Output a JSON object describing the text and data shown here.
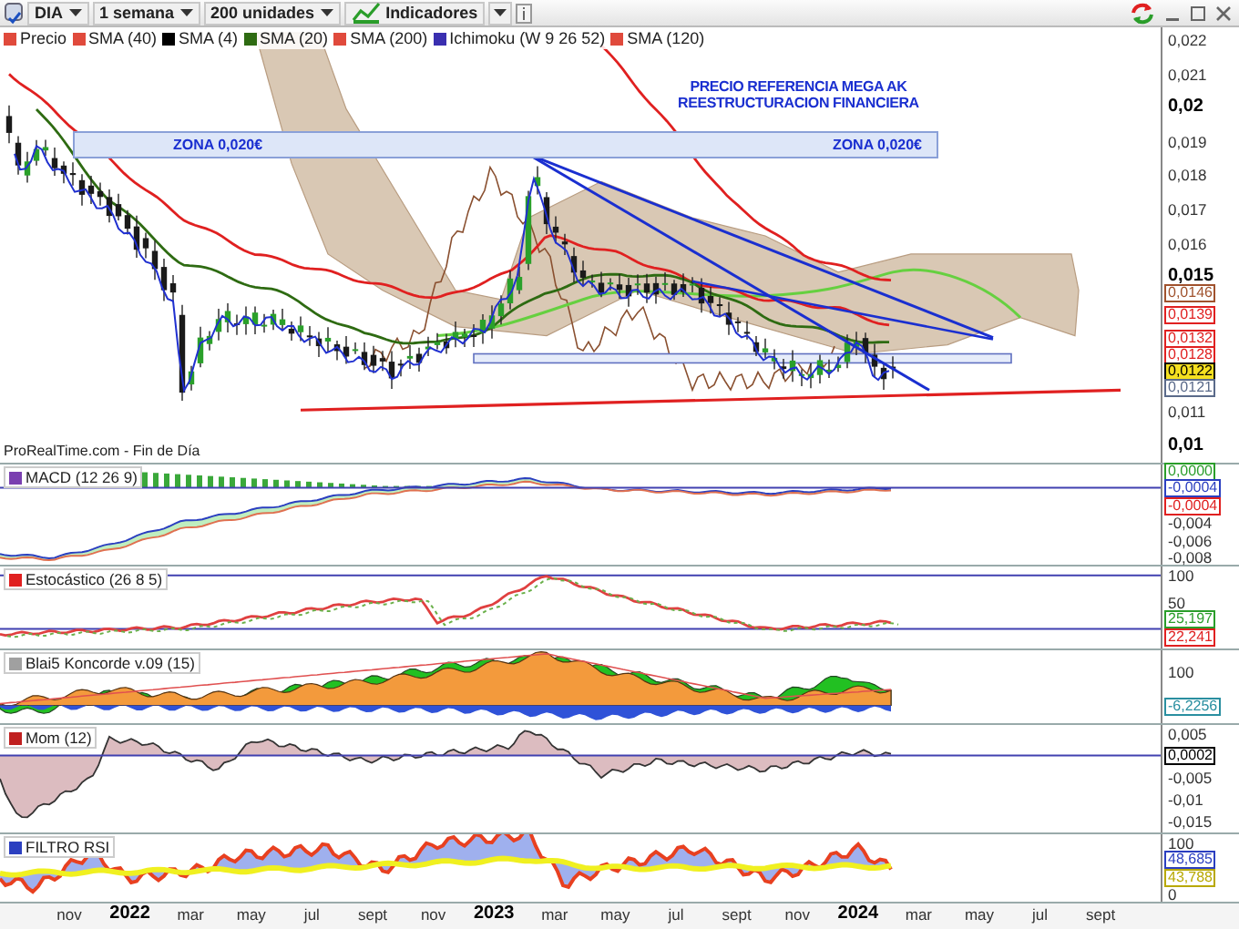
{
  "toolbar": {
    "symbol": "DIA",
    "period": "1 semana",
    "units": "200 unidades",
    "indicators": "Indicadores"
  },
  "legend": [
    {
      "label": "Precio",
      "color": "#e04a3c"
    },
    {
      "label": "SMA (40)",
      "color": "#e04a3c"
    },
    {
      "label": "SMA (4)",
      "color": "#000000"
    },
    {
      "label": "SMA (20)",
      "color": "#2e6b12"
    },
    {
      "label": "SMA (200)",
      "color": "#e04a3c"
    },
    {
      "label": "Ichimoku (W 9 26 52)",
      "color": "#3a2fb0"
    },
    {
      "label": "SMA (120)",
      "color": "#e04a3c"
    }
  ],
  "main": {
    "note_lines": [
      "PRECIO REFERENCIA MEGA AK",
      "REESTRUCTURACION FINANCIERA"
    ],
    "zone_labels": [
      "ZONA 0,020€",
      "ZONA 0,020€"
    ],
    "source": "ProRealTime.com - Fin de Día",
    "y_ticks": [
      {
        "text": "0,022",
        "bold": false
      },
      {
        "text": "0,021",
        "bold": false
      },
      {
        "text": "0,02",
        "bold": true
      },
      {
        "text": "0,019",
        "bold": false
      },
      {
        "text": "0,018",
        "bold": false
      },
      {
        "text": "0,017",
        "bold": false
      },
      {
        "text": "0,016",
        "bold": false
      },
      {
        "text": "0,015",
        "bold": true
      },
      {
        "text": "0,011",
        "bold": false
      },
      {
        "text": "0,01",
        "bold": true
      }
    ],
    "price_tags": [
      {
        "text": "0,0146",
        "color": "#a0522d",
        "highlighted": false
      },
      {
        "text": "0,0139",
        "color": "#e02020",
        "highlighted": false
      },
      {
        "text": "0,0132",
        "color": "#e02020",
        "highlighted": false
      },
      {
        "text": "0,0128",
        "color": "#e02020",
        "highlighted": false
      },
      {
        "text": "0,0122",
        "color": "#000000",
        "highlighted": true
      },
      {
        "text": "0,0121",
        "color": "#5a6a8a",
        "highlighted": false
      }
    ]
  },
  "panels": [
    {
      "kind": "macd",
      "title": "MACD (12 26 9)",
      "color": "#7a3fb0",
      "ticks": [
        "-0,004",
        "-0,006",
        "-0,008"
      ],
      "tags": [
        {
          "text": "0,0000",
          "color": "#2a9d2a"
        },
        {
          "text": "-0,0004",
          "color": "#2b3fc0"
        },
        {
          "text": "-0,0004",
          "color": "#e02020"
        }
      ]
    },
    {
      "kind": "stochastic",
      "title": "Estocástico (26 8 5)",
      "color": "#e02020",
      "ticks": [
        "100",
        "50"
      ],
      "tags": [
        {
          "text": "25,197",
          "color": "#2a9d2a"
        },
        {
          "text": "22,241",
          "color": "#e02020"
        }
      ]
    },
    {
      "kind": "koncorde",
      "title": "Blai5 Koncorde v.09 (15)",
      "color": "#a0a0a0",
      "ticks": [
        "100"
      ],
      "tags": [
        {
          "text": "-6,2256",
          "color": "#2a8fa0"
        }
      ]
    },
    {
      "kind": "momentum",
      "title": "Mom (12)",
      "color": "#c02020",
      "ticks": [
        "0,005",
        "-0,005",
        "-0,01",
        "-0,015"
      ],
      "tags": [
        {
          "text": "0,0002",
          "color": "#000000"
        }
      ]
    },
    {
      "kind": "rsi",
      "title": "FILTRO RSI",
      "color": "#2b3fc0",
      "ticks": [
        "100",
        "0"
      ],
      "tags": [
        {
          "text": "48,685",
          "color": "#2b3fc0"
        },
        {
          "text": "43,788",
          "color": "#b8a800"
        }
      ]
    }
  ],
  "x_axis": [
    {
      "text": "nov",
      "bold": false
    },
    {
      "text": "2022",
      "bold": true
    },
    {
      "text": "mar",
      "bold": false
    },
    {
      "text": "may",
      "bold": false
    },
    {
      "text": "jul",
      "bold": false
    },
    {
      "text": "sept",
      "bold": false
    },
    {
      "text": "nov",
      "bold": false
    },
    {
      "text": "2023",
      "bold": true
    },
    {
      "text": "mar",
      "bold": false
    },
    {
      "text": "may",
      "bold": false
    },
    {
      "text": "jul",
      "bold": false
    },
    {
      "text": "sept",
      "bold": false
    },
    {
      "text": "nov",
      "bold": false
    },
    {
      "text": "2024",
      "bold": true
    },
    {
      "text": "mar",
      "bold": false
    },
    {
      "text": "may",
      "bold": false
    },
    {
      "text": "jul",
      "bold": false
    },
    {
      "text": "sept",
      "bold": false
    }
  ]
}
